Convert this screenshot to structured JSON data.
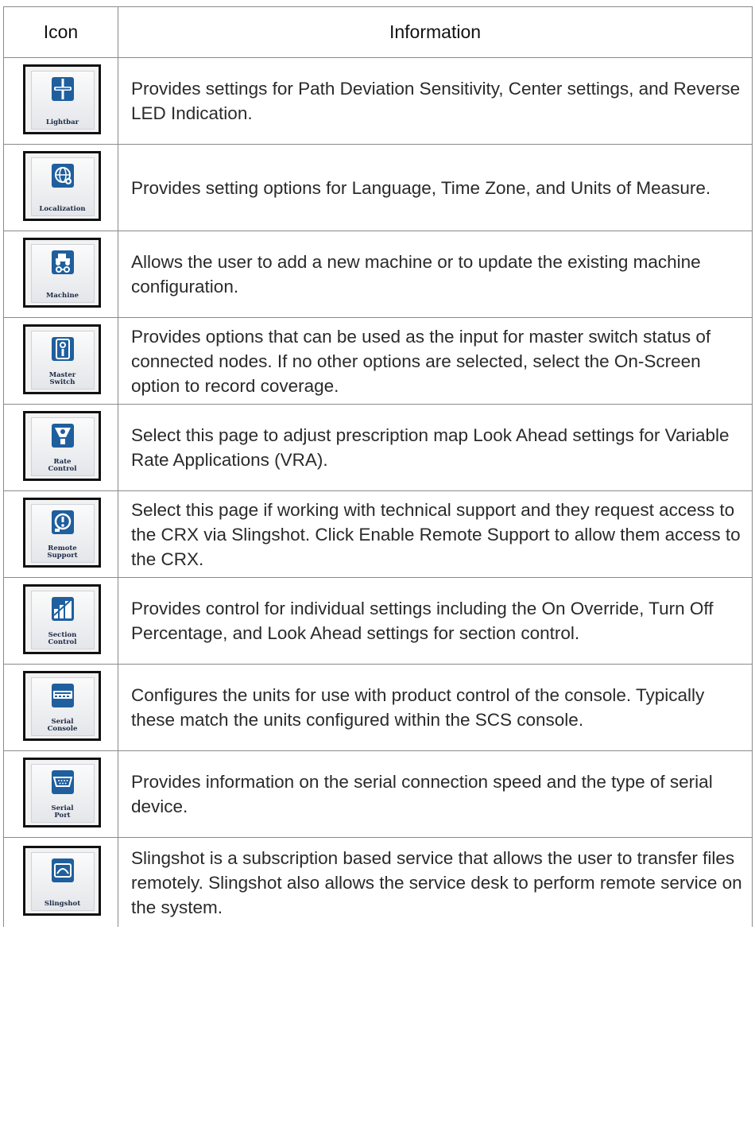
{
  "table": {
    "header": {
      "icon": "Icon",
      "information": "Information"
    },
    "rows": [
      {
        "icon_name": "lightbar-icon",
        "icon_label": "Lightbar",
        "text": "Provides settings for Path Deviation Sensitivity, Center settings, and Reverse LED Indication."
      },
      {
        "icon_name": "localization-icon",
        "icon_label": "Localization",
        "text": "Provides setting options for Language, Time Zone, and Units of Measure."
      },
      {
        "icon_name": "machine-icon",
        "icon_label": "Machine",
        "text": "Allows the user to add a new machine or to update the existing machine configuration."
      },
      {
        "icon_name": "master-switch-icon",
        "icon_label": "Master Switch",
        "text": "Provides options that can be used as the input for master switch status of connected nodes. If no other options are selected, select the On-Screen option to record coverage."
      },
      {
        "icon_name": "rate-control-icon",
        "icon_label": "Rate Control",
        "text": "Select this page to adjust prescription map Look Ahead settings for Variable Rate Applications (VRA)."
      },
      {
        "icon_name": "remote-support-icon",
        "icon_label": "Remote Support",
        "text": "Select this page if working with technical support and they request access to the CRX via Slingshot. Click Enable Remote Support to allow them access to the CRX."
      },
      {
        "icon_name": "section-control-icon",
        "icon_label": "Section Control",
        "text": "Provides control for individual settings including the On Override, Turn Off Percentage, and Look Ahead settings for section control."
      },
      {
        "icon_name": "serial-console-icon",
        "icon_label": "Serial Console",
        "text": "Configures the units for use with product control of the console. Typically these match the units configured within the SCS console."
      },
      {
        "icon_name": "serial-port-icon",
        "icon_label": "Serial Port",
        "text": "Provides information on the serial connection speed and the type of serial device."
      },
      {
        "icon_name": "slingshot-icon",
        "icon_label": "Slingshot",
        "text": "Slingshot is a subscription based service that allows the user to transfer files remotely. Slingshot also allows the service desk to perform remote service on the system."
      }
    ]
  },
  "colors": {
    "icon_blue": "#1f5f9e",
    "icon_label": "#1b2a44",
    "border": "#8a8a8a"
  }
}
